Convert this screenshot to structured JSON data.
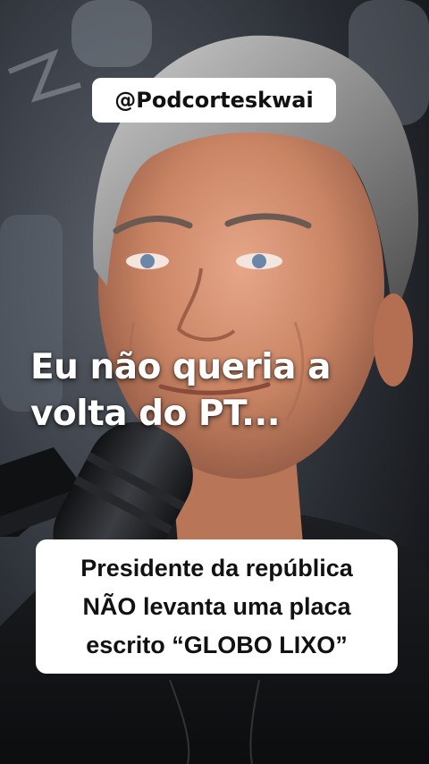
{
  "overlay": {
    "handle": "@Podcorteskwai",
    "headline_lines": [
      "Eu não queria a",
      "volta do PT..."
    ],
    "caption_lines": [
      "Presidente da república",
      "NÃO levanta uma placa",
      "escrito “GLOBO LIXO”"
    ]
  },
  "colors": {
    "badge_background": "#ffffff",
    "badge_text": "#111111",
    "headline_text": "#ffffff"
  }
}
